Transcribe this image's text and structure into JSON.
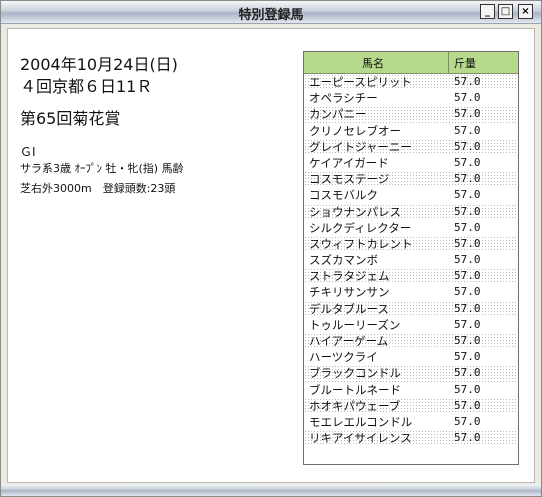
{
  "window": {
    "title": "特別登録馬",
    "min": "_",
    "max": "□",
    "close": "×"
  },
  "race": {
    "date": "2004年10月24日(日)",
    "meeting": "４回京都６日11Ｒ",
    "name": "第65回菊花賞",
    "grade": "ＧⅠ",
    "conditions": "サラ系3歳 ｵｰﾌﾟﾝ 牡・牝(指) 馬齢",
    "course": "芝右外3000m　登録頭数:23頭"
  },
  "table": {
    "headers": {
      "name": "馬名",
      "weight": "斤量"
    },
    "rows": [
      {
        "name": "エーピースピリット",
        "weight": "57.0"
      },
      {
        "name": "オペラシチー",
        "weight": "57.0"
      },
      {
        "name": "カンパニー",
        "weight": "57.0"
      },
      {
        "name": "クリノセレブオー",
        "weight": "57.0"
      },
      {
        "name": "グレイトジャーニー",
        "weight": "57.0"
      },
      {
        "name": "ケイアイガード",
        "weight": "57.0"
      },
      {
        "name": "コスモステージ",
        "weight": "57.0"
      },
      {
        "name": "コスモバルク",
        "weight": "57.0"
      },
      {
        "name": "ショウナンパレス",
        "weight": "57.0"
      },
      {
        "name": "シルクディレクター",
        "weight": "57.0"
      },
      {
        "name": "スウィフトカレント",
        "weight": "57.0"
      },
      {
        "name": "スズカマンボ",
        "weight": "57.0"
      },
      {
        "name": "ストラタジェム",
        "weight": "57.0"
      },
      {
        "name": "チキリサンサン",
        "weight": "57.0"
      },
      {
        "name": "デルタブルース",
        "weight": "57.0"
      },
      {
        "name": "トゥルーリーズン",
        "weight": "57.0"
      },
      {
        "name": "ハイアーゲーム",
        "weight": "57.0"
      },
      {
        "name": "ハーツクライ",
        "weight": "57.0"
      },
      {
        "name": "ブラックコンドル",
        "weight": "57.0"
      },
      {
        "name": "ブルートルネード",
        "weight": "57.0"
      },
      {
        "name": "ホオキパウェーブ",
        "weight": "57.0"
      },
      {
        "name": "モエレエルコンドル",
        "weight": "57.0"
      },
      {
        "name": "リキアイサイレンス",
        "weight": "57.0"
      }
    ]
  },
  "colors": {
    "header_bg": "#b6d98c",
    "titlebar": "#c9d0dc"
  }
}
